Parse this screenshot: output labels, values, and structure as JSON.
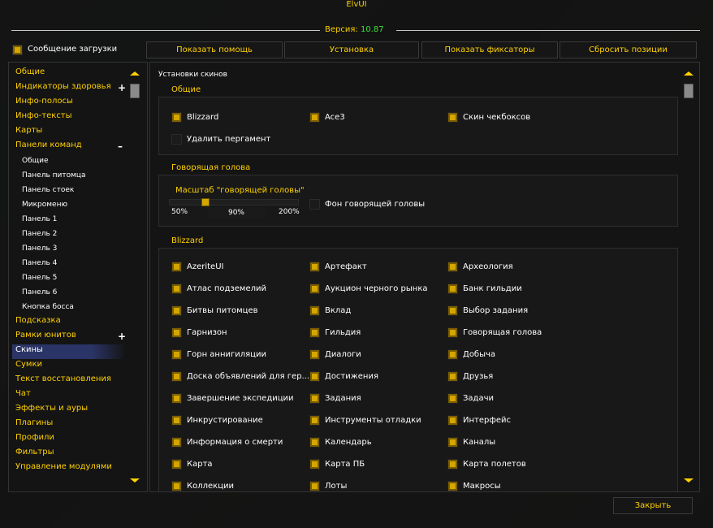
{
  "app": {
    "title": "ElvUI",
    "version_label": "Версия:",
    "version_value": "10.87",
    "accent": "#ffd100",
    "version_color": "#3ce13c"
  },
  "toolbar": {
    "login_message_checkbox": true,
    "login_message_label": "Сообщение загрузки",
    "buttons": [
      "Показать помощь",
      "Установка",
      "Показать фиксаторы",
      "Сбросить позиции"
    ]
  },
  "sidebar": {
    "items": [
      {
        "label": "Общие"
      },
      {
        "label": "Индикаторы здоровья",
        "toggle": "+"
      },
      {
        "label": "Инфо-полосы"
      },
      {
        "label": "Инфо-тексты"
      },
      {
        "label": "Карты"
      },
      {
        "label": "Панели команд",
        "toggle": "–"
      },
      {
        "label": "Общие",
        "sub": true
      },
      {
        "label": "Панель питомца",
        "sub": true
      },
      {
        "label": "Панель стоек",
        "sub": true
      },
      {
        "label": "Микроменю",
        "sub": true
      },
      {
        "label": "Панель 1",
        "sub": true
      },
      {
        "label": "Панель 2",
        "sub": true
      },
      {
        "label": "Панель 3",
        "sub": true
      },
      {
        "label": "Панель 4",
        "sub": true
      },
      {
        "label": "Панель 5",
        "sub": true
      },
      {
        "label": "Панель 6",
        "sub": true
      },
      {
        "label": "Кнопка босса",
        "sub": true
      },
      {
        "label": "Подсказка"
      },
      {
        "label": "Рамки юнитов",
        "toggle": "+"
      },
      {
        "label": "Скины",
        "selected": true
      },
      {
        "label": "Сумки"
      },
      {
        "label": "Текст восстановления"
      },
      {
        "label": "Чат"
      },
      {
        "label": "Эффекты и ауры"
      },
      {
        "label": "Плагины"
      },
      {
        "label": "Профили"
      },
      {
        "label": "Фильтры"
      },
      {
        "label": "Управление модулями"
      }
    ]
  },
  "main": {
    "heading": "Установки скинов",
    "general": {
      "title": "Общие",
      "options": [
        {
          "label": "Blizzard",
          "checked": true
        },
        {
          "label": "Ace3",
          "checked": true
        },
        {
          "label": "Скин чекбоксов",
          "checked": true
        },
        {
          "label": "Удалить пергамент",
          "checked": false
        }
      ]
    },
    "talking_head": {
      "title": "Говорящая голова",
      "scale_label": "Масштаб \"говорящей головы\"",
      "min": "50%",
      "max": "200%",
      "value": "90%",
      "fraction": 0.267,
      "bg_label": "Фон говорящей головы",
      "bg_checked": false
    },
    "blizzard": {
      "title": "Blizzard",
      "col1": [
        "AzeriteUI",
        "Атлас подземелий",
        "Битвы питомцев",
        "Гарнизон",
        "Горн аннигиляции",
        "Доска объявлений для гер...",
        "Завершение экспедиции",
        "Инкрустирование",
        "Информация о смерти",
        "Карта",
        "Коллекции"
      ],
      "col2": [
        "Артефакт",
        "Аукцион черного рынка",
        "Вклад",
        "Гильдия",
        "Диалоги",
        "Достижения",
        "Задания",
        "Инструменты отладки",
        "Календарь",
        "Карта ПБ",
        "Лоты"
      ],
      "col3": [
        "Археология",
        "Банк гильдии",
        "Выбор задания",
        "Говорящая голова",
        "Добыча",
        "Друзья",
        "Задачи",
        "Интерфейс",
        "Каналы",
        "Карта полетов",
        "Макросы"
      ]
    }
  },
  "footer": {
    "close_label": "Закрыть"
  }
}
